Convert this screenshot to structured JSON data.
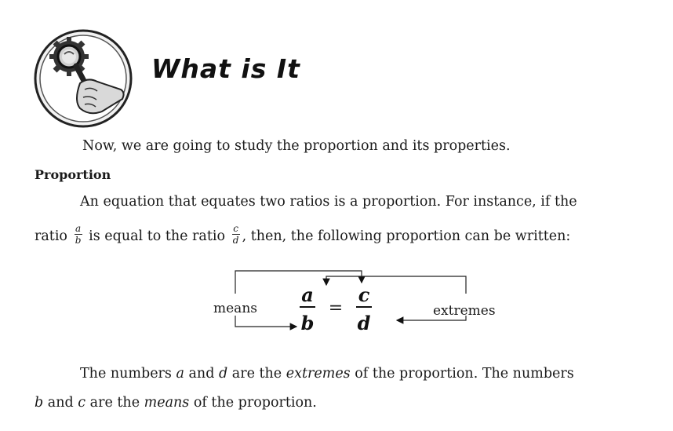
{
  "title": "What is It",
  "intro_text": "Now, we are going to study the proportion and its properties.",
  "section_heading": "Proportion",
  "definition": {
    "part1": "An equation that equates two ratios is a proportion. For instance, if the",
    "part2": "ratio",
    "ratio1": {
      "num": "a",
      "den": "b"
    },
    "part3": "is equal to the ratio",
    "ratio2": {
      "num": "c",
      "den": "d"
    },
    "part4": ", then, the following proportion can be written:"
  },
  "diagram": {
    "means_label": "means",
    "extremes_label": "extremes",
    "num_left": "a",
    "den_left": "b",
    "equals": "=",
    "num_right": "c",
    "den_right": "d"
  },
  "closing": {
    "s1": "The numbers",
    "var_a": "a",
    "s2": "and",
    "var_d": "d",
    "s3": "are the",
    "extremes_word": "extremes",
    "s4": "of the proportion. The numbers",
    "var_b": "b",
    "s5": "and",
    "var_c": "c",
    "s6": "are the",
    "means_word": "means",
    "s7": "of the proportion."
  },
  "icons": {
    "badge": "magnifying-glass-icon"
  }
}
